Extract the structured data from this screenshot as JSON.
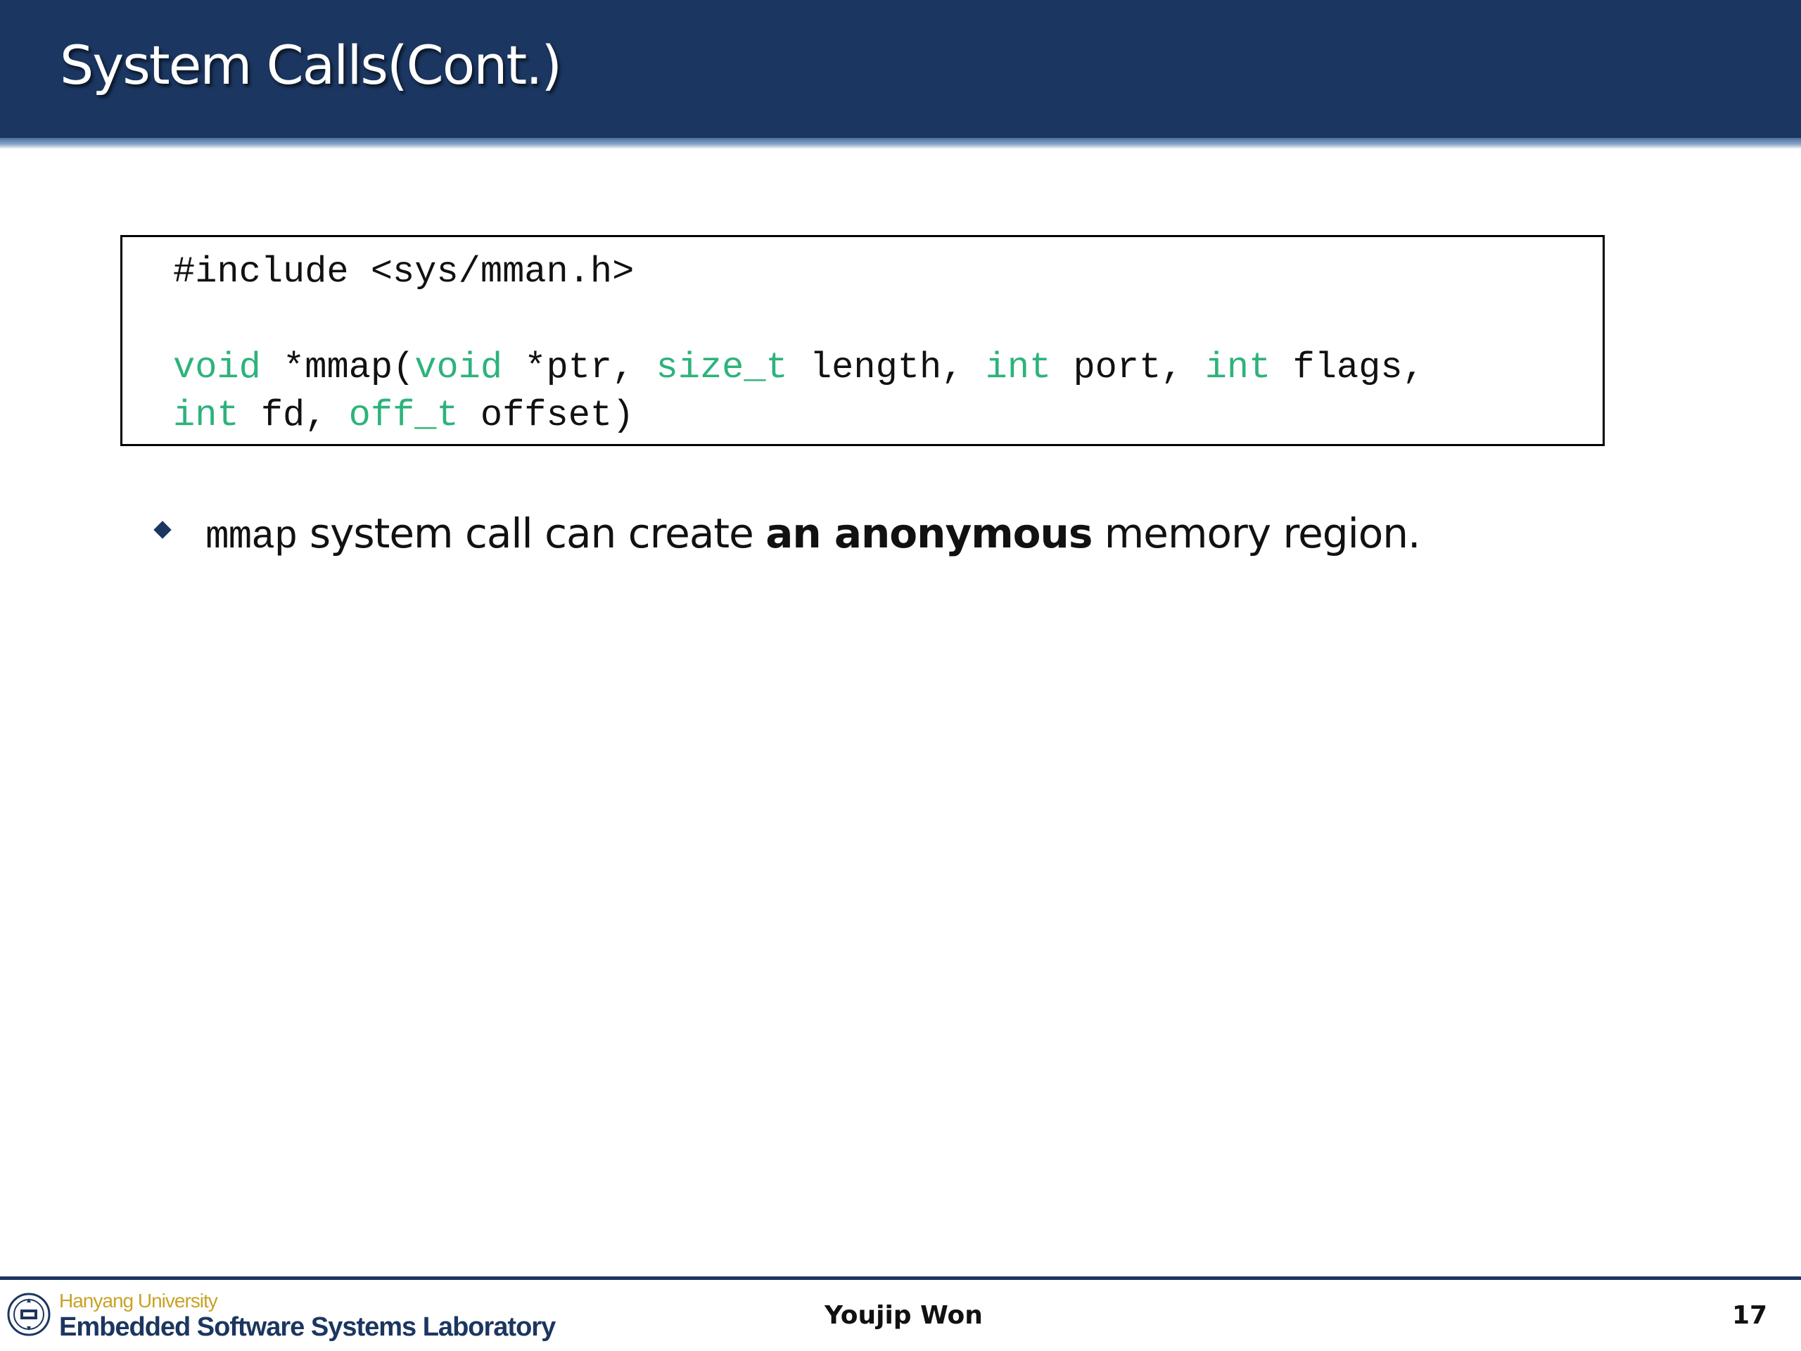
{
  "slide": {
    "title": "System Calls(Cont.)"
  },
  "code": {
    "line1": "#include <sys/mman.h>",
    "line2": {
      "t1": "void",
      "t2": " *mmap(",
      "t3": "void",
      "t4": " *ptr, ",
      "t5": "size_t",
      "t6": " length, ",
      "t7": "int",
      "t8": " port, ",
      "t9": "int",
      "t10": " flags,"
    },
    "line3": {
      "t1": "int",
      "t2": " fd, ",
      "t3": "off_t",
      "t4": " offset)"
    },
    "keyword_color": "#2db37a"
  },
  "bullet": {
    "code": "mmap",
    "text1": " system call can create ",
    "bold": "an anonymous",
    "text2": " memory region."
  },
  "footer": {
    "university": "Hanyang University",
    "lab": "Embedded Software Systems Laboratory",
    "author": "Youjip Won",
    "page": "17"
  },
  "colors": {
    "header": "#1b3660",
    "university": "#c9a227"
  }
}
